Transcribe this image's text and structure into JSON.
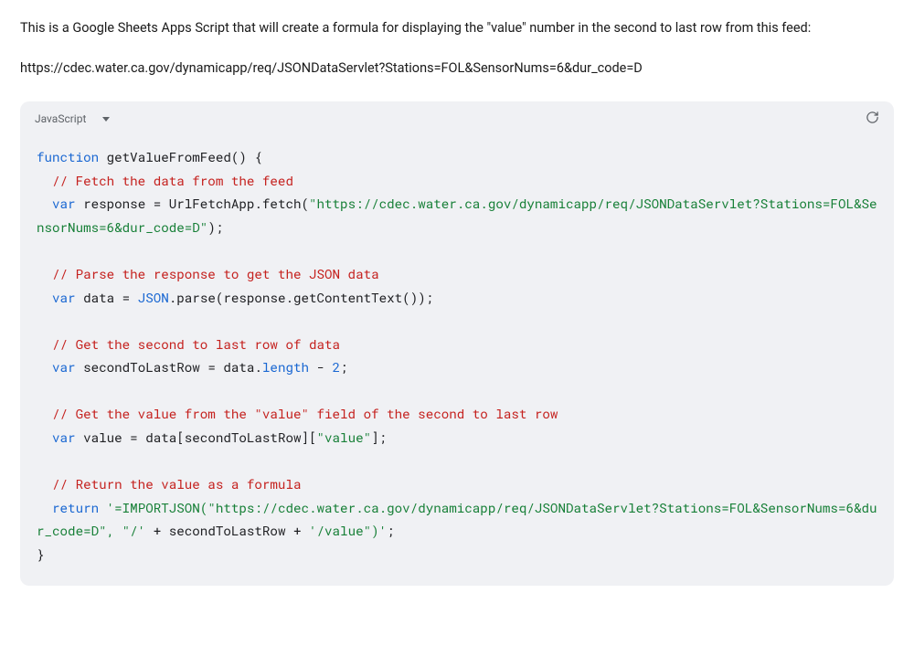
{
  "intro": {
    "text": "This is a Google Sheets Apps Script that will create a formula for displaying the \"value\" number in the second to last row from this feed:",
    "url": "https://cdec.water.ca.gov/dynamicapp/req/JSONDataServlet?Stations=FOL&SensorNums=6&dur_code=D"
  },
  "codeblock": {
    "language": "JavaScript",
    "tokens": [
      {
        "cls": "tok-kw",
        "t": "function"
      },
      {
        "t": " getValueFromFeed() {\n  "
      },
      {
        "cls": "tok-com",
        "t": "// Fetch the data from the feed"
      },
      {
        "t": "\n  "
      },
      {
        "cls": "tok-kw",
        "t": "var"
      },
      {
        "t": " response = UrlFetchApp.fetch("
      },
      {
        "cls": "tok-str",
        "t": "\"https://cdec.water.ca.gov/dynamicapp/req/JSONDataServlet?Stations=FOL&SensorNums=6&dur_code=D\""
      },
      {
        "t": ");\n\n  "
      },
      {
        "cls": "tok-com",
        "t": "// Parse the response to get the JSON data"
      },
      {
        "t": "\n  "
      },
      {
        "cls": "tok-kw",
        "t": "var"
      },
      {
        "t": " data = "
      },
      {
        "cls": "tok-prop",
        "t": "JSON"
      },
      {
        "t": ".parse(response.getContentText());\n\n  "
      },
      {
        "cls": "tok-com",
        "t": "// Get the second to last row of data"
      },
      {
        "t": "\n  "
      },
      {
        "cls": "tok-kw",
        "t": "var"
      },
      {
        "t": " secondToLastRow = data."
      },
      {
        "cls": "tok-prop",
        "t": "length"
      },
      {
        "t": " - "
      },
      {
        "cls": "tok-prop",
        "t": "2"
      },
      {
        "t": ";\n\n  "
      },
      {
        "cls": "tok-com",
        "t": "// Get the value from the \"value\" field of the second to last row"
      },
      {
        "t": "\n  "
      },
      {
        "cls": "tok-kw",
        "t": "var"
      },
      {
        "t": " value = data[secondToLastRow]["
      },
      {
        "cls": "tok-str",
        "t": "\"value\""
      },
      {
        "t": "];\n\n  "
      },
      {
        "cls": "tok-com",
        "t": "// Return the value as a formula"
      },
      {
        "t": "\n  "
      },
      {
        "cls": "tok-kw",
        "t": "return"
      },
      {
        "t": " "
      },
      {
        "cls": "tok-str",
        "t": "'=IMPORTJSON(\"https://cdec.water.ca.gov/dynamicapp/req/JSONDataServlet?Stations=FOL&SensorNums=6&dur_code=D\", \"/'"
      },
      {
        "t": " + secondToLastRow + "
      },
      {
        "cls": "tok-str",
        "t": "'/value\")'"
      },
      {
        "t": ";\n}"
      }
    ]
  }
}
